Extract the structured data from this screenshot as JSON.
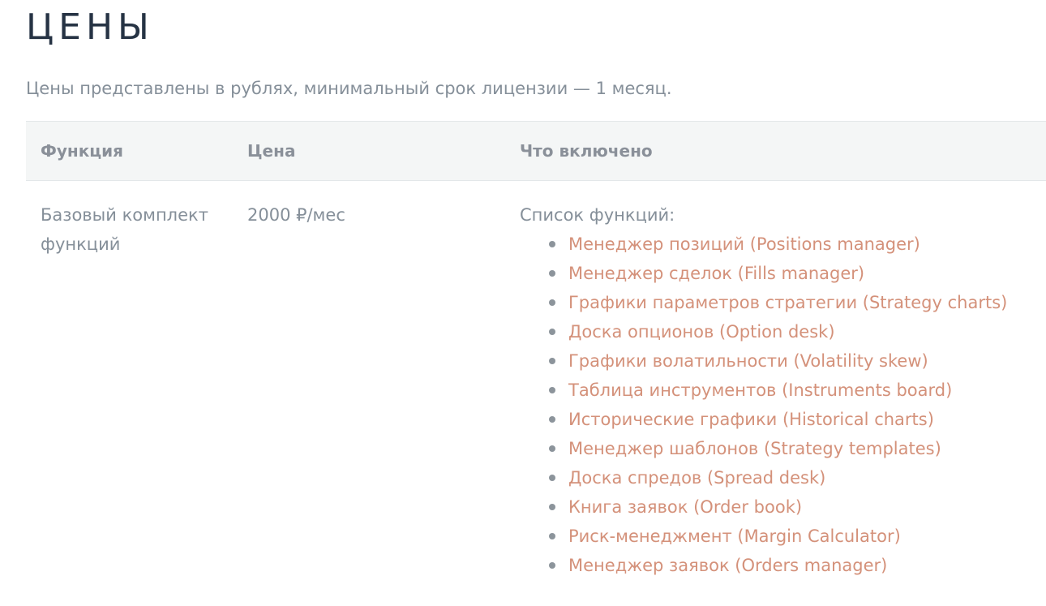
{
  "page": {
    "title": "ЦЕНЫ",
    "intro": "Цены представлены в рублях, минимальный срок лицензии — 1 месяц."
  },
  "table": {
    "headers": [
      "Функция",
      "Цена",
      "Что включено"
    ],
    "rows": [
      {
        "function": "Базовый комплект функций",
        "price": "2000 ₽/мес",
        "included_label": "Список функций:",
        "features": [
          "Менеджер позиций (Positions manager)",
          "Менеджер сделок (Fills manager)",
          "Графики параметров стратегии (Strategy charts)",
          "Доска опционов (Option desk)",
          "Графики волатильности (Volatility skew)",
          "Таблица инструментов (Instruments board)",
          "Исторические графики (Historical charts)",
          "Менеджер шаблонов (Strategy templates)",
          "Доска спредов (Spread desk)",
          "Книга заявок (Order book)",
          "Риск-менеджмент (Margin Calculator)",
          "Менеджер заявок (Orders manager)"
        ]
      }
    ]
  },
  "colors": {
    "title": "#263344",
    "text": "#858f99",
    "link": "#d4917a",
    "header_bg": "#f4f6f6"
  }
}
